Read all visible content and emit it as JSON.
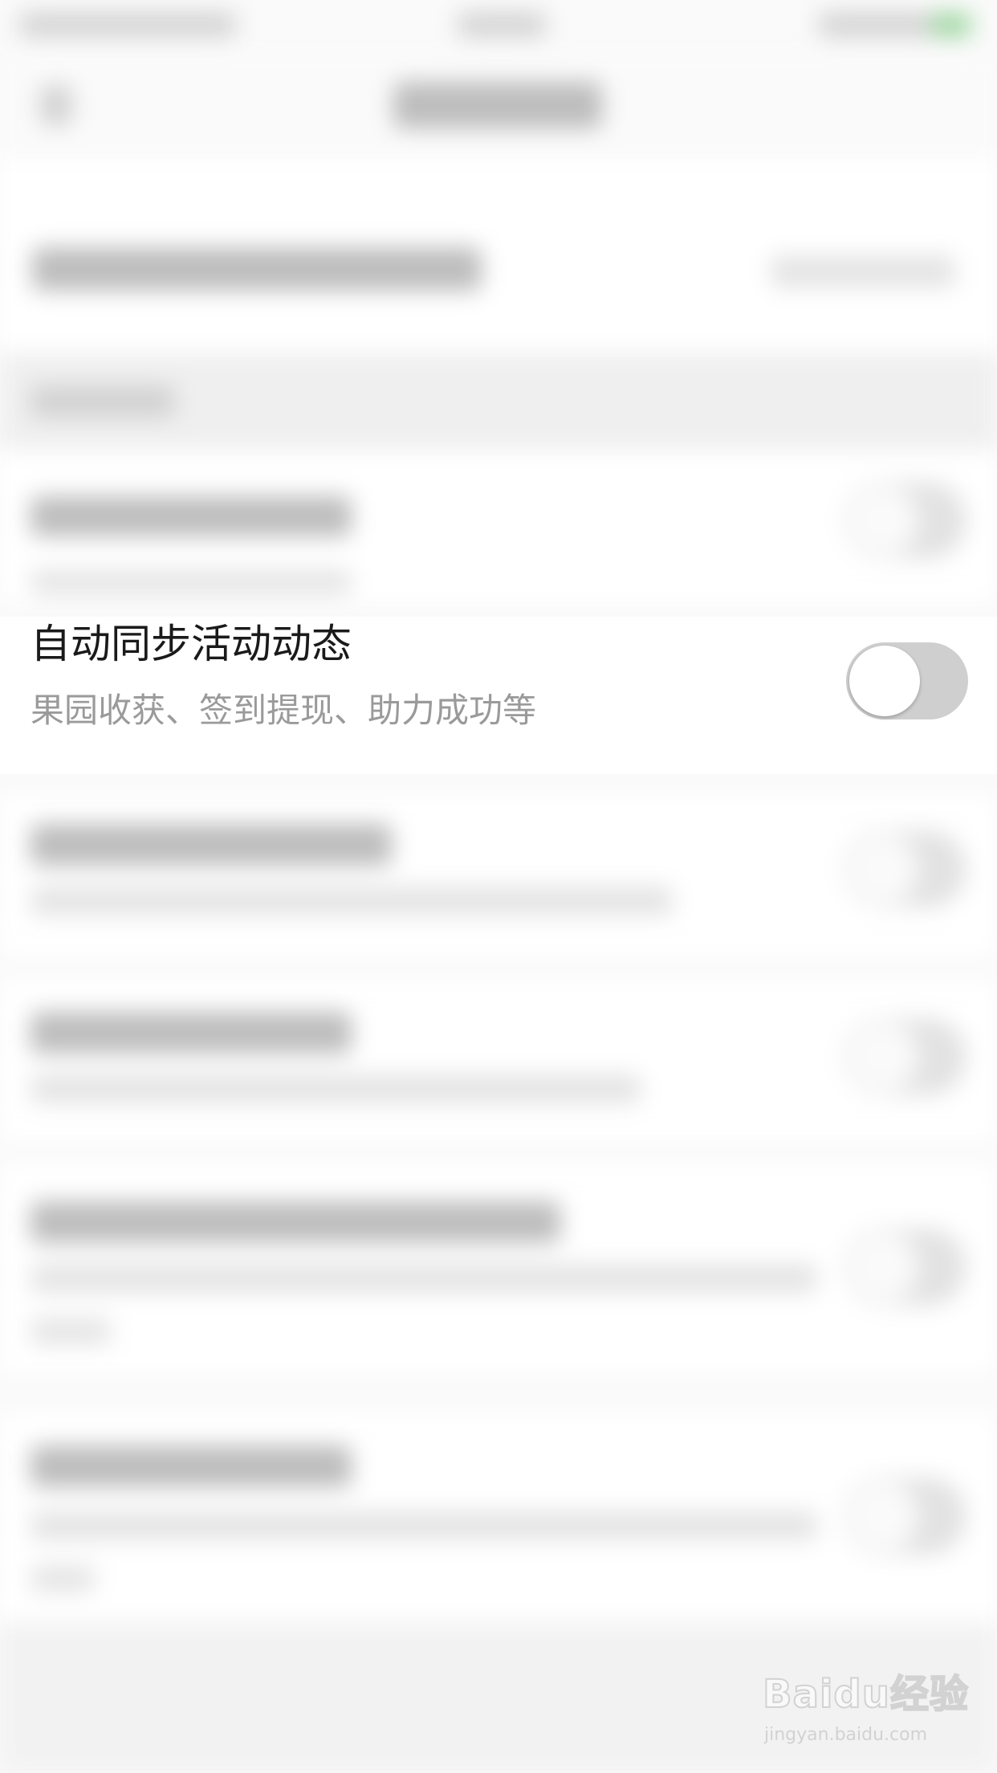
{
  "colors": {
    "background": "#fafafa",
    "title_text": "#1a1a1a",
    "subtitle_text": "#9a9a9a",
    "toggle_off_track": "#cfcfcf",
    "toggle_knob": "#ffffff"
  },
  "setting": {
    "title": "自动同步活动动态",
    "subtitle": "果园收获、签到提现、助力成功等",
    "toggle_on": false
  },
  "watermark": {
    "logo_text": "Baidu经验",
    "url": "jingyan.baidu.com"
  }
}
